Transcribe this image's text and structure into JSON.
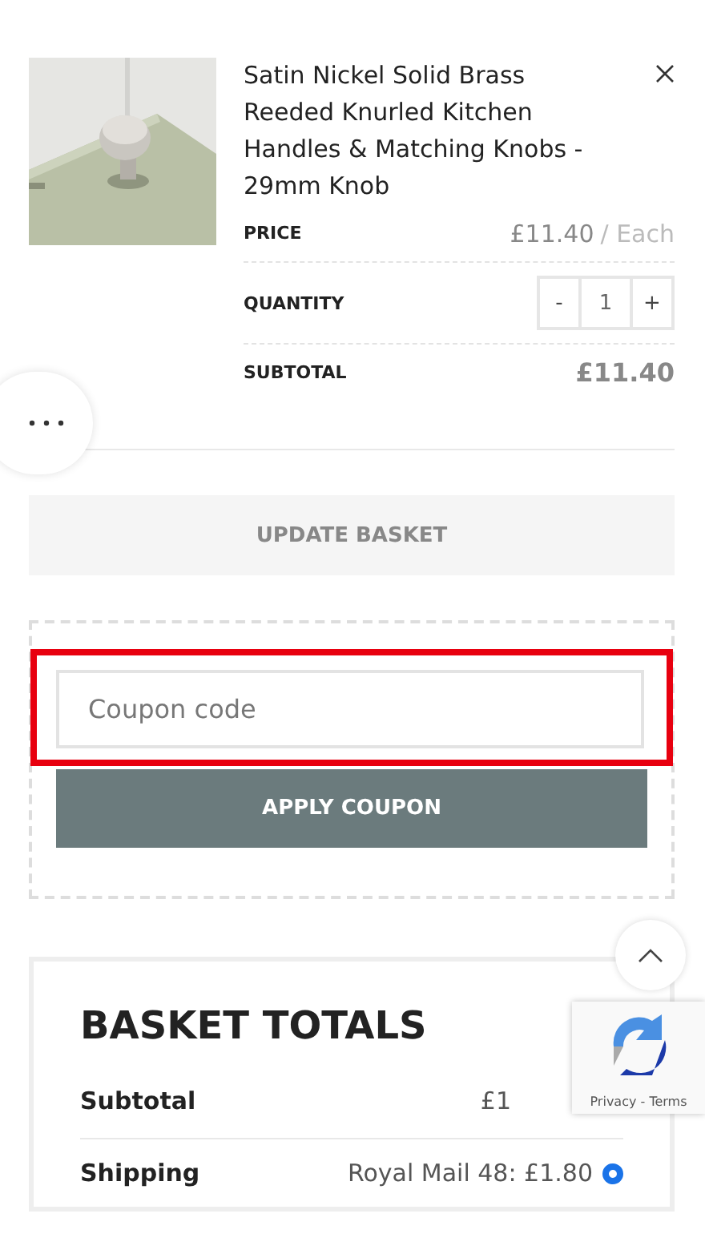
{
  "item": {
    "title": "Satin Nickel Solid Brass Reeded Knurled Kitchen Handles & Matching Knobs - 29mm Knob",
    "price_label": "PRICE",
    "price": "£11.40",
    "price_unit": "/ Each",
    "quantity_label": "QUANTITY",
    "quantity": "1",
    "minus": "-",
    "plus": "+",
    "subtotal_label": "SUBTOTAL",
    "subtotal": "£11.40"
  },
  "update_button": "UPDATE BASKET",
  "coupon": {
    "placeholder": "Coupon code",
    "highlighted": true,
    "button": "APPLY COUPON"
  },
  "totals": {
    "heading": "BASKET TOTALS",
    "rows": [
      {
        "label": "Subtotal",
        "value": "£1"
      },
      {
        "label": "Shipping",
        "value": "Royal Mail 48: £1.80",
        "selected": true
      }
    ]
  },
  "recaptcha": {
    "text": "Privacy - Terms"
  }
}
